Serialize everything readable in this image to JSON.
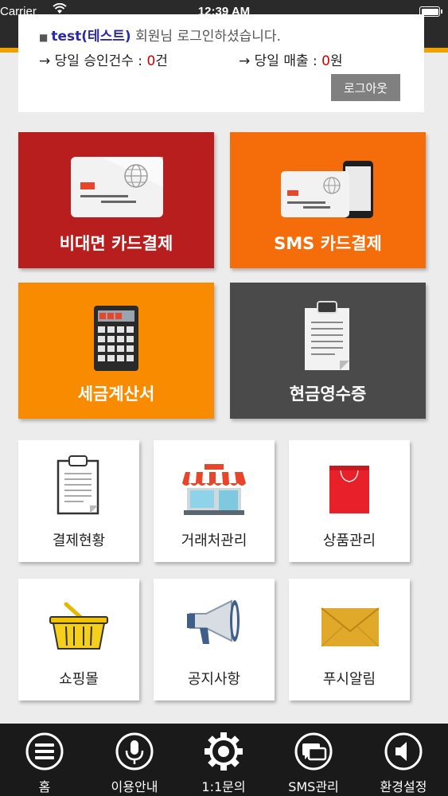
{
  "status_bar": {
    "carrier": "Carrier",
    "time": "12:39 AM",
    "wifi_icon": "wifi-icon",
    "battery_icon": "battery-icon"
  },
  "login": {
    "username": "test(테스트)",
    "message": " 회원님 로그인하셨습니다.",
    "approvals_label": "→ 당일 승인건수 : ",
    "approvals_count": "0",
    "approvals_unit": "건",
    "sales_label": "→ 당일 매출 : ",
    "sales_amount": "0",
    "sales_unit": "원",
    "logout_label": "로그아웃"
  },
  "tiles": {
    "noncontact_card": {
      "label": "비대면 카드결제",
      "color": "#b81e1e",
      "icon": "credit-card-icon"
    },
    "sms_card": {
      "label": "SMS 카드결제",
      "color": "#f56d0a",
      "icon": "card-phone-icon"
    },
    "tax_invoice": {
      "label": "세금계산서",
      "color": "#f98b00",
      "icon": "calculator-icon"
    },
    "cash_receipt": {
      "label": "현금영수증",
      "color": "#4a4a4a",
      "icon": "clipboard-icon"
    },
    "payment_status": {
      "label": "결제현황",
      "icon": "clipboard-icon"
    },
    "client_manage": {
      "label": "거래처관리",
      "icon": "store-icon"
    },
    "product_manage": {
      "label": "상품관리",
      "icon": "shopping-bag-icon"
    },
    "shopping_mall": {
      "label": "쇼핑몰",
      "icon": "basket-icon"
    },
    "notice": {
      "label": "공지사항",
      "icon": "megaphone-icon"
    },
    "push_alert": {
      "label": "푸시알림",
      "icon": "envelope-icon"
    }
  },
  "nav": {
    "home": {
      "label": "홈",
      "icon": "menu-icon"
    },
    "guide": {
      "label": "이용안내",
      "icon": "microphone-icon"
    },
    "inquiry": {
      "label": "1:1문의",
      "icon": "gear-icon"
    },
    "sms": {
      "label": "SMS관리",
      "icon": "chat-icon"
    },
    "settings": {
      "label": "환경설정",
      "icon": "speaker-icon"
    }
  },
  "colors": {
    "accent": "#f0a000",
    "header": "#2a2a2a",
    "background": "#ececec",
    "bottom_bar": "#1a1a1a"
  }
}
